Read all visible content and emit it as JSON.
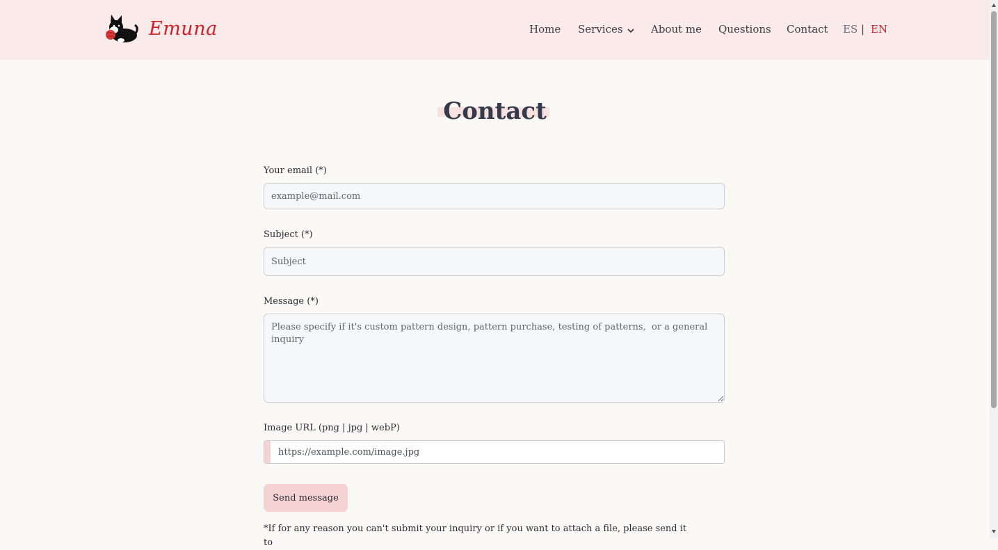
{
  "brand": {
    "name": "Emuna"
  },
  "nav": {
    "items": [
      {
        "label": "Home"
      },
      {
        "label": "Services"
      },
      {
        "label": "About me"
      },
      {
        "label": "Questions"
      },
      {
        "label": "Contact"
      }
    ],
    "lang_es": "ES",
    "lang_sep": "|",
    "lang_en": "EN"
  },
  "page": {
    "title": "Contact"
  },
  "form": {
    "email_label": "Your email (*)",
    "email_placeholder": "example@mail.com",
    "subject_label": "Subject (*)",
    "subject_placeholder": "Subject",
    "message_label": "Message (*)",
    "message_placeholder": "Please specify if it's custom pattern design, pattern purchase, testing of patterns,  or a general inquiry",
    "image_label": "Image URL (png | jpg | webP)",
    "image_placeholder": "https://example.com/image.jpg",
    "send_label": "Send message"
  },
  "note": "*If for any reason you can't submit your inquiry or if you want to attach a file, please send it to",
  "colors": {
    "accent": "#d11f2a",
    "header_bg": "#fbeaea",
    "button_bg": "#f4d3d2",
    "page_bg": "#fbf9f5"
  },
  "icons": {
    "logo": "cat-with-yarn-icon",
    "services_dropdown": "chevron-down-icon"
  }
}
